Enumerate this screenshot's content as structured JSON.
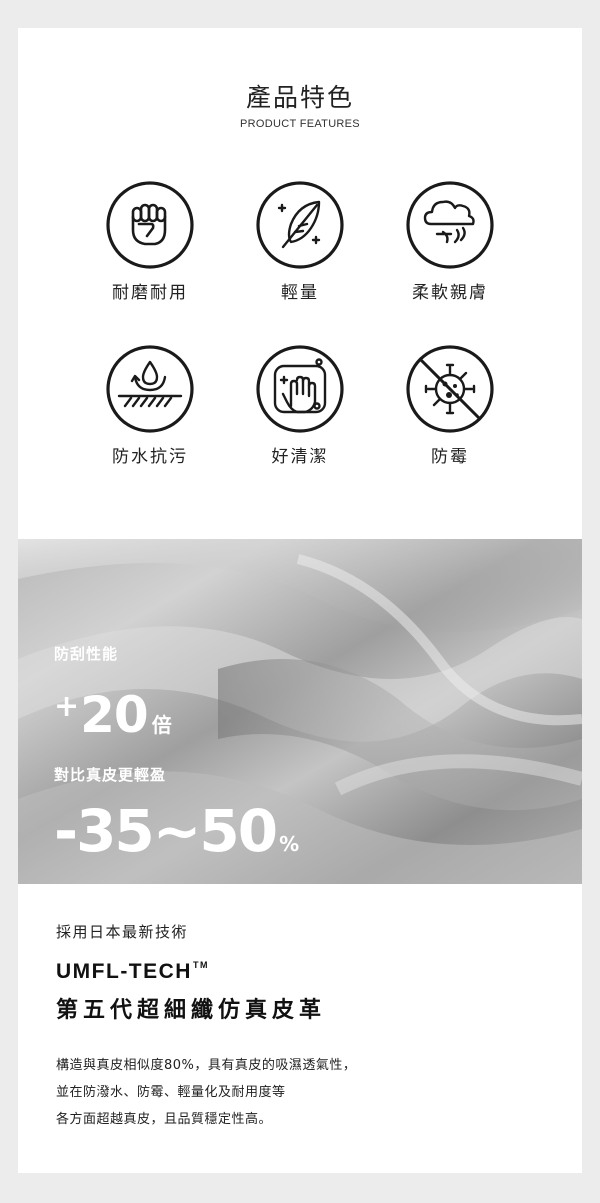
{
  "header": {
    "title": "產品特色",
    "subtitle": "PRODUCT FEATURES"
  },
  "features": [
    {
      "icon": "fist-icon",
      "label": "耐磨耐用"
    },
    {
      "icon": "feather-icon",
      "label": "輕量"
    },
    {
      "icon": "soft-cloud-icon",
      "label": "柔軟親膚"
    },
    {
      "icon": "water-drop-icon",
      "label": "防水抗污"
    },
    {
      "icon": "wipe-hand-icon",
      "label": "好清潔"
    },
    {
      "icon": "no-mold-icon",
      "label": "防霉"
    }
  ],
  "banner": {
    "scratch_label": "防刮性能",
    "scratch_plus": "+",
    "scratch_value": "20",
    "scratch_unit": "倍",
    "weight_label": "對比真皮更輕盈",
    "weight_value": "-35~50",
    "weight_unit": "%"
  },
  "tech": {
    "intro": "採用日本最新技術",
    "name": "UMFL-TECH",
    "trademark": "TM",
    "headline": "第五代超細纖仿真皮革",
    "paragraph_lines": [
      "構造與真皮相似度80%，具有真皮的吸濕透氣性，",
      "並在防潑水、防霉、輕量化及耐用度等",
      "各方面超越真皮，且品質穩定性高。"
    ]
  },
  "colors": {
    "background": "#ececec",
    "card": "#ffffff",
    "text": "#222222",
    "banner_text": "#ffffff"
  }
}
